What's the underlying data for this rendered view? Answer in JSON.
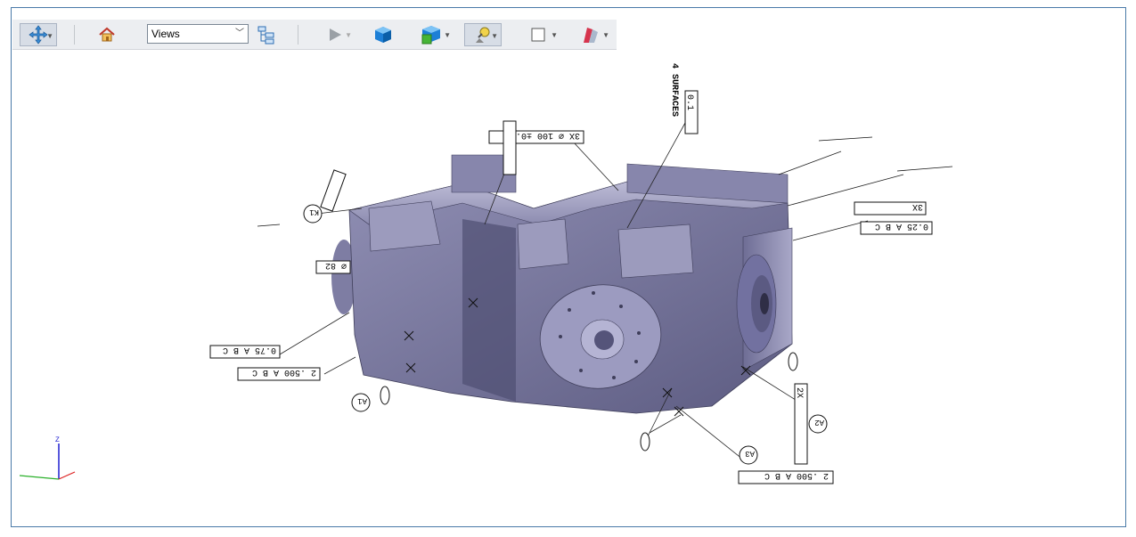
{
  "toolbar": {
    "views_label": "Views",
    "buttons": [
      "move-icon",
      "home-icon",
      "tree-icon",
      "play-icon",
      "cube-icon",
      "cubes-icon",
      "lamp-icon",
      "square-icon",
      "section-icon"
    ]
  },
  "axes": {
    "z_label": "Z"
  },
  "annotations": {
    "a1": "0.75 A B C",
    "a2": "2 .500 A B C",
    "a3": "2 .500 A B C",
    "a4": "0.25 A B C",
    "a5": "3X",
    "a6": "2X",
    "a7": "⌀ 82",
    "a8": "0.1",
    "a9": "4 SURFACES",
    "a10": "3X ⌀ 100 ±0.18",
    "datum_a1": "A1",
    "datum_a2": "A2",
    "datum_a3": "A3",
    "datum_k1": "K1"
  }
}
